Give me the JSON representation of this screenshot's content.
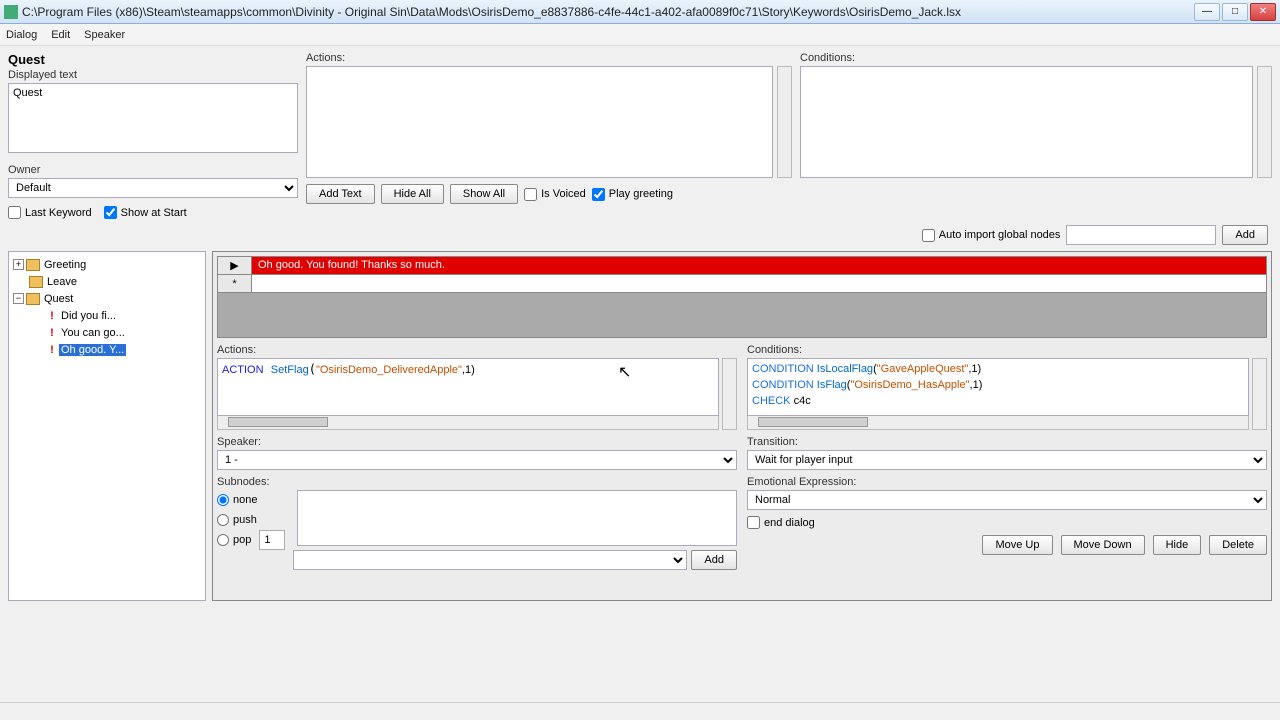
{
  "window": {
    "title": "C:\\Program Files (x86)\\Steam\\steamapps\\common\\Divinity - Original Sin\\Data\\Mods\\OsirisDemo_e8837886-c4fe-44c1-a402-afa0089f0c71\\Story\\Keywords\\OsirisDemo_Jack.lsx"
  },
  "menu": {
    "dialog": "Dialog",
    "edit": "Edit",
    "speaker": "Speaker"
  },
  "quest": {
    "heading": "Quest",
    "displayed_label": "Displayed text",
    "displayed_value": "Quest",
    "owner_label": "Owner",
    "owner_value": "Default"
  },
  "topActions": {
    "label": "Actions:"
  },
  "topConditions": {
    "label": "Conditions:"
  },
  "buttons": {
    "addText": "Add Text",
    "hideAll": "Hide All",
    "showAll": "Show All",
    "add": "Add",
    "addSub": "Add",
    "moveUp": "Move Up",
    "moveDown": "Move Down",
    "hide": "Hide",
    "delete": "Delete"
  },
  "checks": {
    "isVoiced": "Is Voiced",
    "playGreeting": "Play greeting",
    "lastKeyword": "Last Keyword",
    "showAtStart": "Show at Start",
    "autoImport": "Auto import global nodes",
    "endDialog": "end dialog"
  },
  "tree": {
    "greeting": "Greeting",
    "leave": "Leave",
    "quest": "Quest",
    "q1": "Did you fi...",
    "q2": "You can go...",
    "q3": "Oh good. Y..."
  },
  "grid": {
    "row1": "Oh good. You found! Thanks so much.",
    "marker1": "▶",
    "marker2": "*"
  },
  "editor": {
    "actions_label": "Actions:",
    "conditions_label": "Conditions:",
    "speaker_label": "Speaker:",
    "speaker_value": "1 -",
    "transition_label": "Transition:",
    "transition_value": "Wait for player input",
    "subnodes_label": "Subnodes:",
    "emo_label": "Emotional Expression:",
    "emo_value": "Normal",
    "radio_none": "none",
    "radio_push": "push",
    "radio_pop": "pop",
    "pop_val": "1"
  },
  "code": {
    "action_kw": "ACTION",
    "action_fn": "SetFlag",
    "action_str": "\"OsirisDemo_DeliveredApple\"",
    "action_tail": ",1)",
    "cond1_kw": "CONDITION",
    "cond1_fn": "IsLocalFlag",
    "cond1_str": "\"GaveAppleQuest\"",
    "cond1_tail": ",1)",
    "cond2_kw": "CONDITION",
    "cond2_fn": "IsFlag",
    "cond2_str": "\"OsirisDemo_HasApple\"",
    "cond2_tail": ",1)",
    "check_kw": "CHECK",
    "check_tail": "c4c"
  }
}
